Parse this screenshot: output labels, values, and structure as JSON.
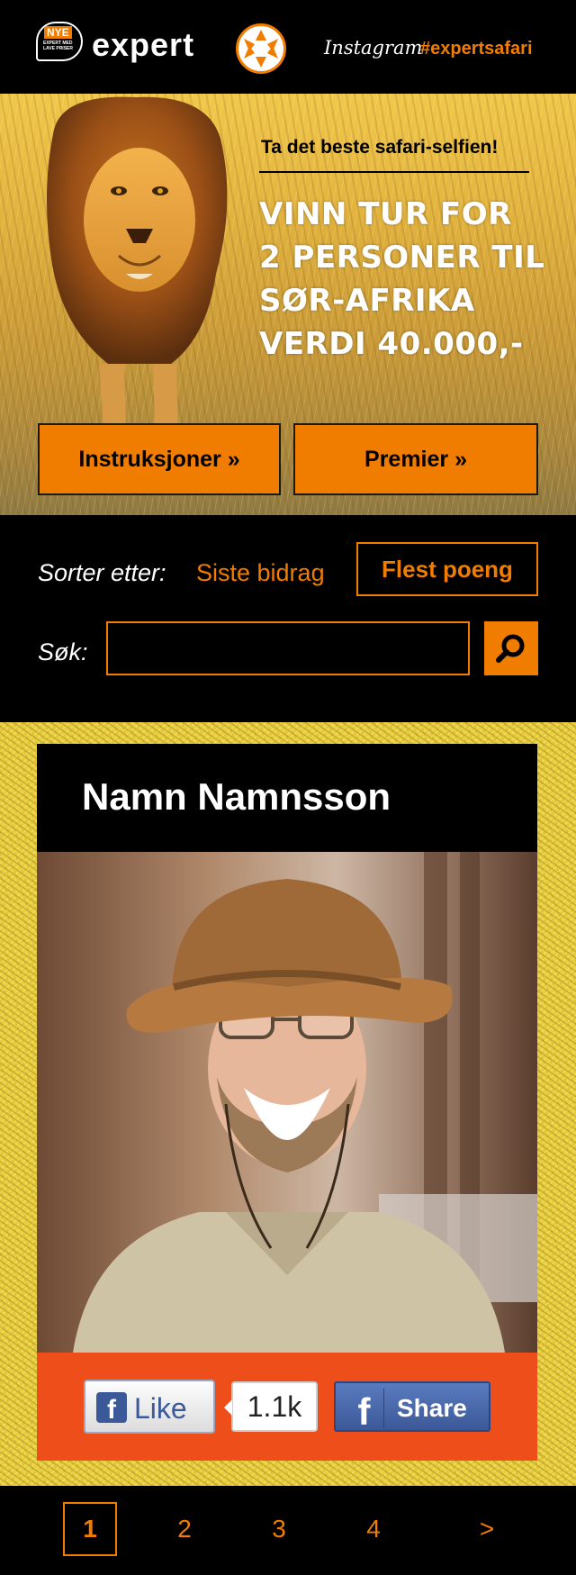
{
  "header": {
    "badge_top": "NYE",
    "badge_tagline": "EXPERT MED LAVE PRISER",
    "logo_text": "expert",
    "social_platform": "Instagram",
    "hashtag": "#expertsafari"
  },
  "hero": {
    "subtitle": "Ta det beste safari-selfien!",
    "headline": [
      "VINN TUR FOR",
      "2 PERSONER TIL",
      "SØR-AFRIKA",
      "VERDI 40.000,-"
    ],
    "buttons": {
      "instructions": "Instruksjoner »",
      "prizes": "Premier »"
    }
  },
  "filter": {
    "sort_label": "Sorter etter:",
    "sort_options": [
      "Siste bidrag",
      "Flest poeng"
    ],
    "selected_sort": "Flest poeng",
    "search_label": "Søk:",
    "search_value": ""
  },
  "entry": {
    "name": "Namn Namnsson",
    "like_label": "Like",
    "like_count": "1.1k",
    "share_label": "Share"
  },
  "pagination": {
    "pages": [
      "1",
      "2",
      "3",
      "4"
    ],
    "current": "1",
    "next": ">"
  },
  "colors": {
    "accent": "#f07c00",
    "social_bar": "#ee4f1a",
    "facebook": "#3b5998",
    "grass": "#e9cf3e",
    "background": "#000000"
  },
  "icons": {
    "logo_mark": "expert-cross-icon",
    "search": "search-icon",
    "facebook": "facebook-icon"
  }
}
